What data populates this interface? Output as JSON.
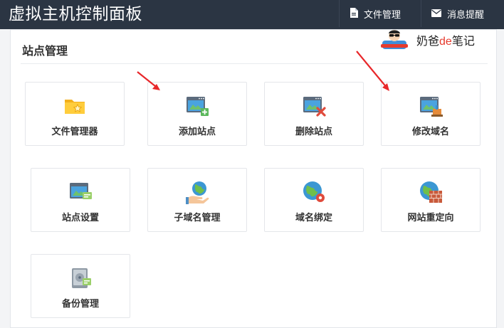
{
  "header": {
    "title": "虚拟主机控制面板",
    "nav": [
      {
        "label": "文件管理",
        "icon": "file-icon"
      },
      {
        "label": "消息提醒",
        "icon": "envelope-icon"
      }
    ]
  },
  "panel": {
    "title": "站点管理"
  },
  "watermark": {
    "prefix": "奶爸",
    "accent": "de",
    "suffix": "笔记",
    "accent_color": "#e63b2e"
  },
  "tiles": [
    {
      "label": "文件管理器",
      "icon": "folder-star-icon"
    },
    {
      "label": "添加站点",
      "icon": "site-add-icon"
    },
    {
      "label": "删除站点",
      "icon": "site-delete-icon"
    },
    {
      "label": "修改域名",
      "icon": "site-edit-domain-icon"
    },
    {
      "label": "站点设置",
      "icon": "site-settings-icon"
    },
    {
      "label": "子域名管理",
      "icon": "globe-hand-icon"
    },
    {
      "label": "域名绑定",
      "icon": "globe-pin-icon"
    },
    {
      "label": "网站重定向",
      "icon": "globe-wall-icon"
    },
    {
      "label": "备份管理",
      "icon": "backup-disk-icon"
    }
  ],
  "colors": {
    "header_bg": "#2b3543",
    "arrow": "#e8272a"
  }
}
